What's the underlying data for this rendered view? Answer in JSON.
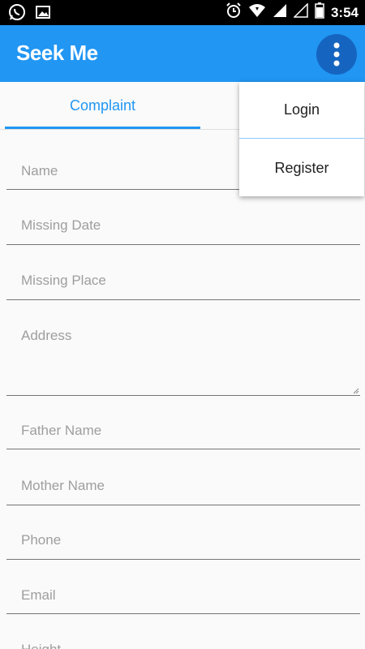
{
  "status_bar": {
    "time": "3:54",
    "icons": [
      "whatsapp-icon",
      "image-icon",
      "alarm-icon",
      "wifi-icon",
      "signal-icon",
      "signal-empty-icon",
      "battery-icon"
    ]
  },
  "app_bar": {
    "title": "Seek Me",
    "menu_icon": "more-vert-icon",
    "color": "#2196f3"
  },
  "tabs": [
    {
      "label": "Complaint",
      "selected": true
    }
  ],
  "form": {
    "fields": [
      {
        "placeholder": "Name"
      },
      {
        "placeholder": "Missing Date"
      },
      {
        "placeholder": "Missing Place"
      },
      {
        "placeholder": "Address"
      },
      {
        "placeholder": "Father Name"
      },
      {
        "placeholder": "Mother Name"
      },
      {
        "placeholder": "Phone"
      },
      {
        "placeholder": "Email"
      },
      {
        "placeholder": "Height"
      }
    ]
  },
  "menu": {
    "items": [
      {
        "label": "Login"
      },
      {
        "label": "Register"
      }
    ]
  }
}
